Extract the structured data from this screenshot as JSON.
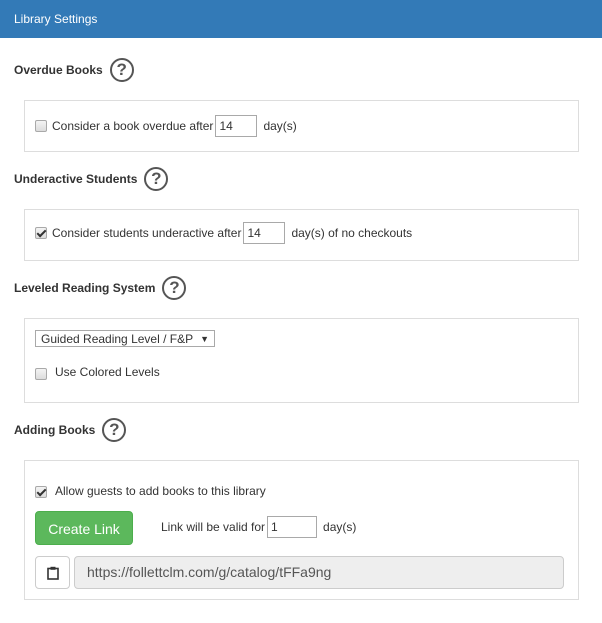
{
  "header": {
    "title": "Library Settings"
  },
  "sections": {
    "overdue": {
      "title": "Overdue Books",
      "checkbox_checked": false,
      "label_before": "Consider a book overdue after",
      "days_value": "14",
      "label_after": "day(s)"
    },
    "underactive": {
      "title": "Underactive Students",
      "checkbox_checked": true,
      "label_before": "Consider students underactive after",
      "days_value": "14",
      "label_after": "day(s) of no checkouts"
    },
    "leveled": {
      "title": "Leveled Reading System",
      "select_value": "Guided Reading Level / F&P",
      "select_arrow": "▼",
      "colored_checked": false,
      "colored_label": "Use Colored Levels"
    },
    "adding": {
      "title": "Adding Books",
      "guests_checked": true,
      "guests_label": "Allow guests to add books to this library",
      "create_link_label": "Create Link",
      "valid_label": "Link will be valid for",
      "valid_value": "1",
      "valid_after": "day(s)",
      "url": "https://follettclm.com/g/catalog/tFFa9ng"
    }
  },
  "icons": {
    "help": "?",
    "clipboard": "clipboard-icon"
  },
  "colors": {
    "header_bg": "#337ab7",
    "create_btn": "#5cb85c"
  }
}
